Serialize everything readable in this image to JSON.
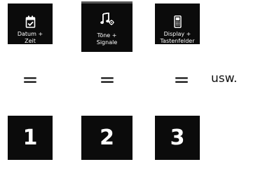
{
  "menu_tiles": [
    {
      "label": "Datum +\nZeit",
      "icon": "calendar-check-icon"
    },
    {
      "label": "Töne +\nSignale",
      "icon": "music-note-settings-icon"
    },
    {
      "label": "Display +\nTastenfelder",
      "icon": "phone-display-icon"
    }
  ],
  "equals_symbol": "=",
  "continuation_text": "usw.",
  "number_keys": [
    "1",
    "2",
    "3"
  ],
  "colors": {
    "tile_background": "#0b0b0b",
    "tile_text": "#ffffff",
    "selected_border": "#555555",
    "page_text": "#111111"
  }
}
